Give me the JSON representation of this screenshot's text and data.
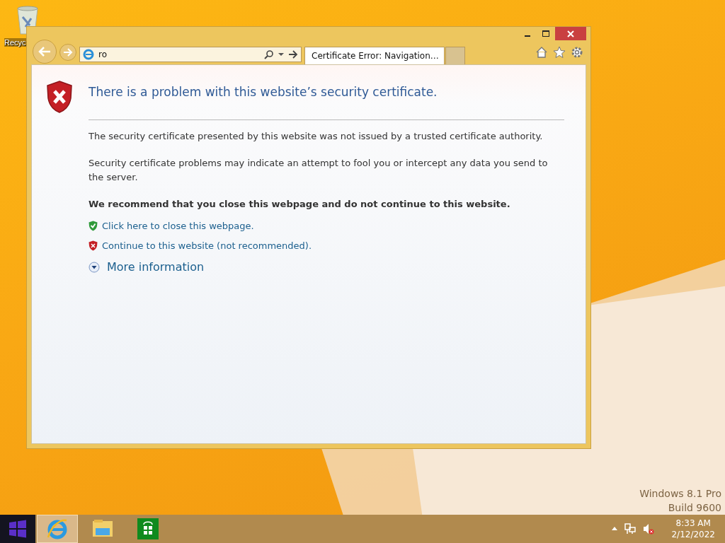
{
  "desktop": {
    "icons": [
      {
        "label": "Recyc"
      }
    ],
    "os_watermark": [
      "Windows 8.1 Pro",
      "Build 9600"
    ]
  },
  "browser": {
    "address": {
      "value": "ro"
    },
    "tabs": [
      {
        "title": "Certificate Error: Navigation…",
        "selected": true
      }
    ],
    "page": {
      "heading": "There is a problem with this website’s security certificate.",
      "paragraphs": [
        "The security certificate presented by this website was not issued by a trusted certificate authority.",
        "Security certificate problems may indicate an attempt to fool you or intercept any data you send to the server."
      ],
      "recommendation": "We recommend that you close this webpage and do not continue to this website.",
      "links": [
        {
          "kind": "safe",
          "text": "Click here to close this webpage."
        },
        {
          "kind": "danger",
          "text": "Continue to this website (not recommended)."
        }
      ],
      "more_info": {
        "text": "More information",
        "expanded": false
      }
    }
  },
  "taskbar": {
    "apps": [
      {
        "kind": "ie",
        "selected": true
      },
      {
        "kind": "explorer",
        "selected": false
      },
      {
        "kind": "store",
        "selected": false
      }
    ],
    "clock": {
      "time": "8:33 AM",
      "date": "2/12/2022"
    }
  }
}
